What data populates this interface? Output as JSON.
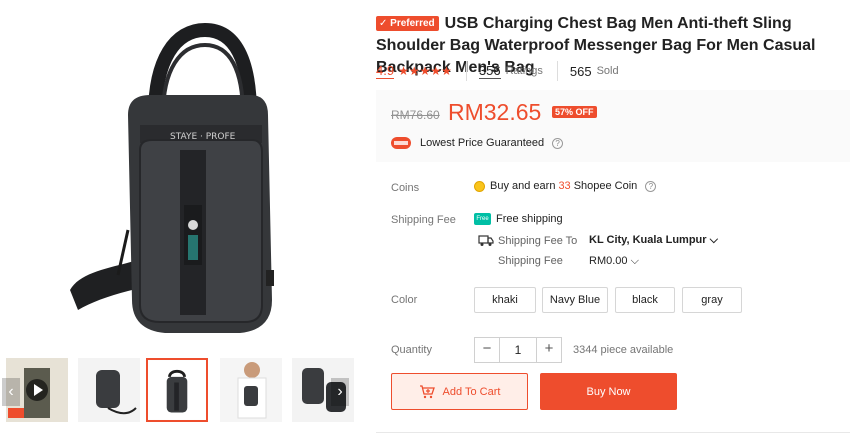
{
  "product": {
    "preferred_badge": "Preferred",
    "title": "USB Charging Chest Bag Men Anti-theft Sling Shoulder Bag Waterproof Messenger Bag For Men Casual Backpack Men's Bag"
  },
  "stats": {
    "rating": "4.9",
    "stars": "★★★★★",
    "ratings_count": "356",
    "ratings_label": "Ratings",
    "sold_count": "565",
    "sold_label": "Sold"
  },
  "price": {
    "original": "RM76.60",
    "current": "RM32.65",
    "discount": "57% OFF",
    "guarantee": "Lowest Price Guaranteed"
  },
  "coins": {
    "label": "Coins",
    "text_before": "Buy and earn",
    "amount": "33",
    "text_after": "Shopee Coin"
  },
  "shipping": {
    "label": "Shipping Fee",
    "free_badge": "Free",
    "free_text": "Free shipping",
    "to_label": "Shipping Fee To",
    "location": "KL City, Kuala Lumpur",
    "fee_label": "Shipping Fee",
    "fee_value": "RM0.00"
  },
  "color": {
    "label": "Color",
    "options": [
      "khaki",
      "Navy Blue",
      "black",
      "gray"
    ]
  },
  "quantity": {
    "label": "Quantity",
    "minus": "−",
    "value": "1",
    "plus": "+",
    "stock": "3344 piece available"
  },
  "actions": {
    "add_to_cart": "Add To Cart",
    "buy_now": "Buy Now"
  },
  "gallery": {
    "prev": "‹",
    "next": "›",
    "active_index": 2,
    "colors": {
      "accent": "#ee4d2d",
      "bag": "#3a3c3f",
      "bag_dark": "#232426"
    }
  }
}
